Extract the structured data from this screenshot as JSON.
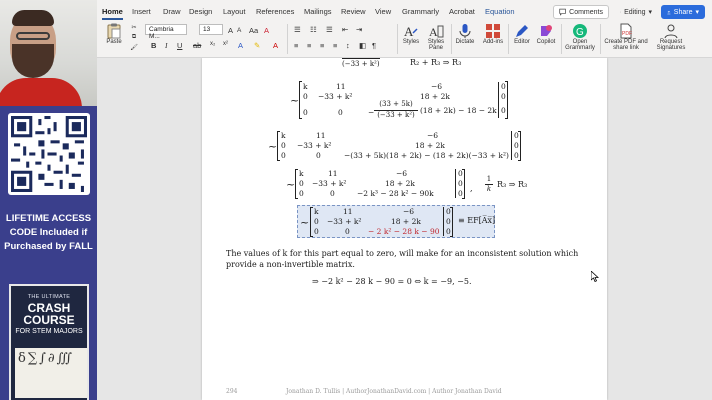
{
  "ribbon": {
    "tabs": [
      "Home",
      "Insert",
      "Draw",
      "Design",
      "Layout",
      "References",
      "Mailings",
      "Review",
      "View",
      "Grammarly",
      "Acrobat",
      "Equation"
    ],
    "active_tab": "Home",
    "comments_label": "Comments",
    "editing_label": "Editing",
    "share_label": "Share",
    "paste_label": "Paste",
    "font_name": "Cambria M...",
    "font_size": "13",
    "styles_label": "Styles",
    "styles_pane_label": "Styles Pane",
    "dictate_label": "Dictate",
    "addins_label": "Add-ins",
    "editor_label": "Editor",
    "copilot_label": "Copilot",
    "grammarly_label": "Open Grammarly",
    "pdf_label": "Create PDF and share link",
    "signatures_label": "Request Signatures",
    "bold": "B",
    "italic": "I",
    "underline": "U",
    "accent_color": "#2b579a"
  },
  "promo": {
    "line1": "LIFETIME ACCESS",
    "line2": "CODE Included if",
    "line3": "Purchased by FALL",
    "book_top": "THE ULTIMATE",
    "book_title_1": "CRASH COURSE",
    "book_title_2": "FOR STEM MAJORS"
  },
  "document": {
    "row_op_1": "R₂ + R₃ ⇒ R₃",
    "row_op_1_denom": "(−33 + k²)",
    "m1": {
      "r1": [
        "k",
        "11",
        "−6",
        "0"
      ],
      "r2": [
        "0",
        "−33 + k²",
        "18 + 2k",
        "0"
      ],
      "r3a": "(33 + 5k)",
      "r3b": "(−33 + k²)",
      "r3c": "(18 + 2k) − 18 − 2k",
      "r3_last": "0",
      "r3_zero1": "0",
      "r3_zero2": "0"
    },
    "m2": {
      "r1": [
        "k",
        "11",
        "−6",
        "0"
      ],
      "r2": [
        "0",
        "−33 + k²",
        "18 + 2k",
        "0"
      ],
      "r3": [
        "0",
        "0",
        "−(33 + 5k)(18 + 2k) − (18 + 2k)(−33 + k²)",
        "0"
      ]
    },
    "m3": {
      "r1": [
        "k",
        "11",
        "−6",
        "0"
      ],
      "r2": [
        "0",
        "−33 + k²",
        "18 + 2k",
        "0"
      ],
      "r3": [
        "0",
        "0",
        "−2 k³ − 28 k² − 90k",
        "0"
      ],
      "op": "R₃ ⇒ R₃",
      "frac_num": "1",
      "frac_den": "k"
    },
    "m4": {
      "r1": [
        "k",
        "11",
        "−6",
        "0"
      ],
      "r2": [
        "0",
        "−33 + k²",
        "18 + 2k",
        "0"
      ],
      "r3": [
        "0",
        "0",
        "− 2 k² − 28 k − 90",
        "0"
      ],
      "ef": "≡ EF[A̅x̅]"
    },
    "tilde": "~",
    "paragraph": "The values of k for this part equal to zero, will make for an inconsistent solution which provide a non-invertible matrix.",
    "final_eq": "⇒  −2 k² − 28 k − 90 = 0  ⇔  k = −9, −5.",
    "page_number": "294",
    "footer_text": "Jonathan D. Tullis | AuthorJonathanDavid.com | Author Jonathan David"
  }
}
